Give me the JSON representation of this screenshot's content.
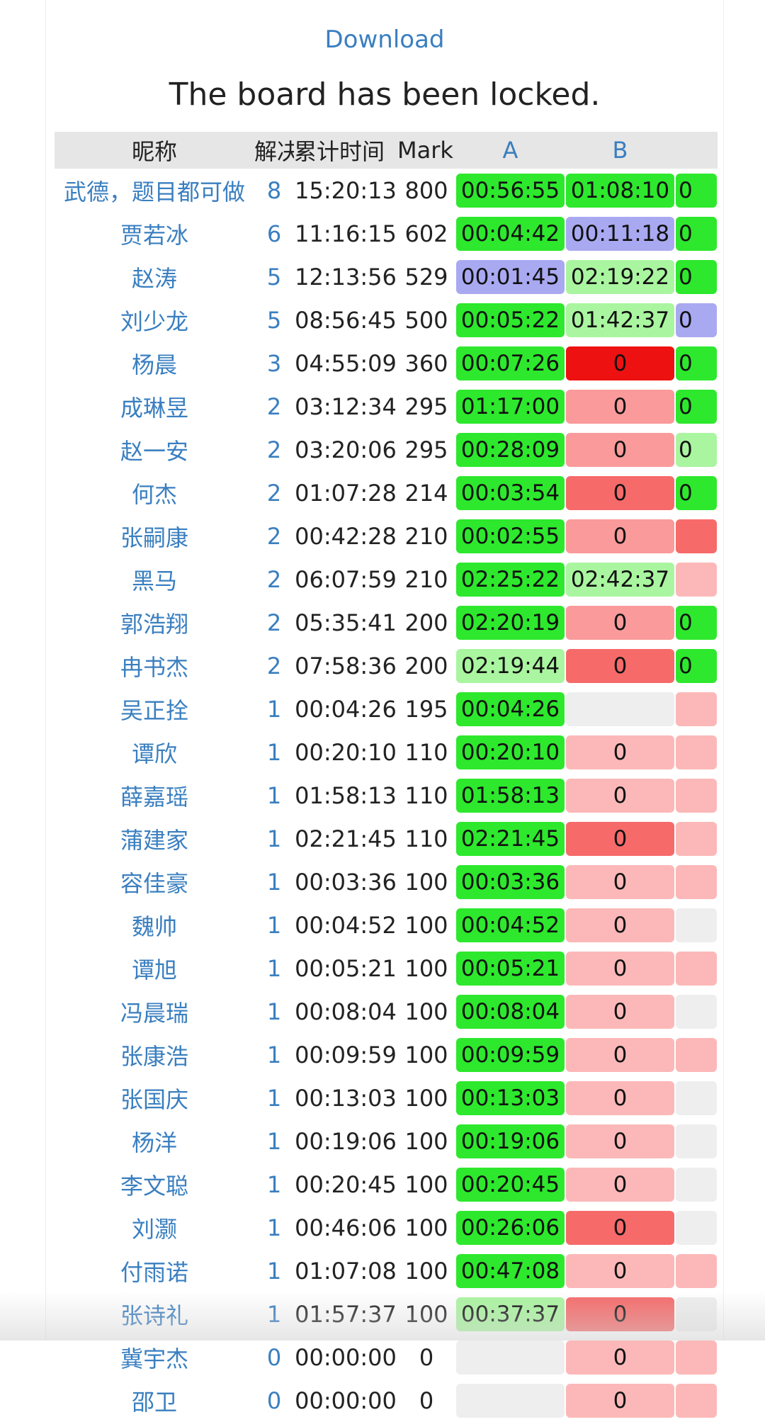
{
  "header": {
    "download_label": "Download",
    "lock_message": "The board has been locked."
  },
  "table": {
    "columns": [
      "昵称",
      "解决",
      "累计时间",
      "Mark",
      "A",
      "B",
      ""
    ],
    "rows": [
      {
        "name": "武德，题目都可做",
        "solved": "8",
        "time": "15:20:13",
        "mark": "800",
        "cells": [
          {
            "v": "00:56:55",
            "s": "ac"
          },
          {
            "v": "01:08:10",
            "s": "ac"
          },
          {
            "v": "0",
            "s": "ac"
          }
        ]
      },
      {
        "name": "贾若冰",
        "solved": "6",
        "time": "11:16:15",
        "mark": "602",
        "cells": [
          {
            "v": "00:04:42",
            "s": "ac"
          },
          {
            "v": "00:11:18",
            "s": "fb"
          },
          {
            "v": "0",
            "s": "ac"
          }
        ]
      },
      {
        "name": "赵涛",
        "solved": "5",
        "time": "12:13:56",
        "mark": "529",
        "cells": [
          {
            "v": "00:01:45",
            "s": "fb"
          },
          {
            "v": "02:19:22",
            "s": "acl"
          },
          {
            "v": "0",
            "s": "ac"
          }
        ]
      },
      {
        "name": "刘少龙",
        "solved": "5",
        "time": "08:56:45",
        "mark": "500",
        "cells": [
          {
            "v": "00:05:22",
            "s": "ac"
          },
          {
            "v": "01:42:37",
            "s": "acl"
          },
          {
            "v": "0",
            "s": "fb"
          }
        ]
      },
      {
        "name": "杨晨",
        "solved": "3",
        "time": "04:55:09",
        "mark": "360",
        "cells": [
          {
            "v": "00:07:26",
            "s": "ac"
          },
          {
            "v": "0",
            "s": "wa3"
          },
          {
            "v": "0",
            "s": "ac"
          }
        ]
      },
      {
        "name": "成琳昱",
        "solved": "2",
        "time": "03:12:34",
        "mark": "295",
        "cells": [
          {
            "v": "01:17:00",
            "s": "ac"
          },
          {
            "v": "0",
            "s": "wa1"
          },
          {
            "v": "0",
            "s": "ac"
          }
        ]
      },
      {
        "name": "赵一安",
        "solved": "2",
        "time": "03:20:06",
        "mark": "295",
        "cells": [
          {
            "v": "00:28:09",
            "s": "ac"
          },
          {
            "v": "0",
            "s": "wa1"
          },
          {
            "v": "0",
            "s": "acl"
          }
        ]
      },
      {
        "name": "何杰",
        "solved": "2",
        "time": "01:07:28",
        "mark": "214",
        "cells": [
          {
            "v": "00:03:54",
            "s": "ac"
          },
          {
            "v": "0",
            "s": "wa2"
          },
          {
            "v": "0",
            "s": "ac"
          }
        ]
      },
      {
        "name": "张嗣康",
        "solved": "2",
        "time": "00:42:28",
        "mark": "210",
        "cells": [
          {
            "v": "00:02:55",
            "s": "ac"
          },
          {
            "v": "0",
            "s": "wa1"
          },
          {
            "v": "",
            "s": "wa2"
          }
        ]
      },
      {
        "name": "黑马",
        "solved": "2",
        "time": "06:07:59",
        "mark": "210",
        "cells": [
          {
            "v": "02:25:22",
            "s": "ac"
          },
          {
            "v": "02:42:37",
            "s": "acl"
          },
          {
            "v": "",
            "s": "wa0"
          }
        ]
      },
      {
        "name": "郭浩翔",
        "solved": "2",
        "time": "05:35:41",
        "mark": "200",
        "cells": [
          {
            "v": "02:20:19",
            "s": "ac"
          },
          {
            "v": "0",
            "s": "wa1"
          },
          {
            "v": "0",
            "s": "ac"
          }
        ]
      },
      {
        "name": "冉书杰",
        "solved": "2",
        "time": "07:58:36",
        "mark": "200",
        "cells": [
          {
            "v": "02:19:44",
            "s": "acl"
          },
          {
            "v": "0",
            "s": "wa2"
          },
          {
            "v": "0",
            "s": "ac"
          }
        ]
      },
      {
        "name": "吴正拴",
        "solved": "1",
        "time": "00:04:26",
        "mark": "195",
        "cells": [
          {
            "v": "00:04:26",
            "s": "ac"
          },
          {
            "v": "",
            "s": "none"
          },
          {
            "v": "",
            "s": "wa0"
          }
        ]
      },
      {
        "name": "谭欣",
        "solved": "1",
        "time": "00:20:10",
        "mark": "110",
        "cells": [
          {
            "v": "00:20:10",
            "s": "ac"
          },
          {
            "v": "0",
            "s": "wa0"
          },
          {
            "v": "",
            "s": "wa0"
          }
        ]
      },
      {
        "name": "薛嘉瑶",
        "solved": "1",
        "time": "01:58:13",
        "mark": "110",
        "cells": [
          {
            "v": "01:58:13",
            "s": "ac"
          },
          {
            "v": "0",
            "s": "wa0"
          },
          {
            "v": "",
            "s": "wa0"
          }
        ]
      },
      {
        "name": "蒲建家",
        "solved": "1",
        "time": "02:21:45",
        "mark": "110",
        "cells": [
          {
            "v": "02:21:45",
            "s": "ac"
          },
          {
            "v": "0",
            "s": "wa2"
          },
          {
            "v": "",
            "s": "wa0"
          }
        ]
      },
      {
        "name": "容佳豪",
        "solved": "1",
        "time": "00:03:36",
        "mark": "100",
        "cells": [
          {
            "v": "00:03:36",
            "s": "ac"
          },
          {
            "v": "0",
            "s": "wa0"
          },
          {
            "v": "",
            "s": "wa0"
          }
        ]
      },
      {
        "name": "魏帅",
        "solved": "1",
        "time": "00:04:52",
        "mark": "100",
        "cells": [
          {
            "v": "00:04:52",
            "s": "ac"
          },
          {
            "v": "0",
            "s": "wa0"
          },
          {
            "v": "",
            "s": "none"
          }
        ]
      },
      {
        "name": "谭旭",
        "solved": "1",
        "time": "00:05:21",
        "mark": "100",
        "cells": [
          {
            "v": "00:05:21",
            "s": "ac"
          },
          {
            "v": "0",
            "s": "wa0"
          },
          {
            "v": "",
            "s": "wa0"
          }
        ]
      },
      {
        "name": "冯晨瑞",
        "solved": "1",
        "time": "00:08:04",
        "mark": "100",
        "cells": [
          {
            "v": "00:08:04",
            "s": "ac"
          },
          {
            "v": "0",
            "s": "wa0"
          },
          {
            "v": "",
            "s": "none"
          }
        ]
      },
      {
        "name": "张康浩",
        "solved": "1",
        "time": "00:09:59",
        "mark": "100",
        "cells": [
          {
            "v": "00:09:59",
            "s": "ac"
          },
          {
            "v": "0",
            "s": "wa0"
          },
          {
            "v": "",
            "s": "wa0"
          }
        ]
      },
      {
        "name": "张国庆",
        "solved": "1",
        "time": "00:13:03",
        "mark": "100",
        "cells": [
          {
            "v": "00:13:03",
            "s": "ac"
          },
          {
            "v": "0",
            "s": "wa0"
          },
          {
            "v": "",
            "s": "none"
          }
        ]
      },
      {
        "name": "杨洋",
        "solved": "1",
        "time": "00:19:06",
        "mark": "100",
        "cells": [
          {
            "v": "00:19:06",
            "s": "ac"
          },
          {
            "v": "0",
            "s": "wa0"
          },
          {
            "v": "",
            "s": "none"
          }
        ]
      },
      {
        "name": "李文聪",
        "solved": "1",
        "time": "00:20:45",
        "mark": "100",
        "cells": [
          {
            "v": "00:20:45",
            "s": "ac"
          },
          {
            "v": "0",
            "s": "wa0"
          },
          {
            "v": "",
            "s": "none"
          }
        ]
      },
      {
        "name": "刘灏",
        "solved": "1",
        "time": "00:46:06",
        "mark": "100",
        "cells": [
          {
            "v": "00:26:06",
            "s": "ac"
          },
          {
            "v": "0",
            "s": "wa2"
          },
          {
            "v": "",
            "s": "none"
          }
        ]
      },
      {
        "name": "付雨诺",
        "solved": "1",
        "time": "01:07:08",
        "mark": "100",
        "cells": [
          {
            "v": "00:47:08",
            "s": "ac"
          },
          {
            "v": "0",
            "s": "wa0"
          },
          {
            "v": "",
            "s": "wa0"
          }
        ]
      },
      {
        "name": "张诗礼",
        "solved": "1",
        "time": "01:57:37",
        "mark": "100",
        "cells": [
          {
            "v": "00:37:37",
            "s": "acl"
          },
          {
            "v": "0",
            "s": "wa2"
          },
          {
            "v": "",
            "s": "none"
          }
        ]
      },
      {
        "name": "冀宇杰",
        "solved": "0",
        "time": "00:00:00",
        "mark": "0",
        "cells": [
          {
            "v": "",
            "s": "none"
          },
          {
            "v": "0",
            "s": "wa0"
          },
          {
            "v": "",
            "s": "wa0"
          }
        ]
      },
      {
        "name": "邵卫",
        "solved": "0",
        "time": "00:00:00",
        "mark": "0",
        "cells": [
          {
            "v": "",
            "s": "none"
          },
          {
            "v": "0",
            "s": "wa0"
          },
          {
            "v": "",
            "s": "wa0"
          }
        ]
      }
    ]
  },
  "colors": {
    "ac": "#2de82d",
    "acl": "#aaf5a0",
    "fb": "#a9a9f2",
    "wa0": "#fcb8b8",
    "wa1": "#fa9a9a",
    "wa2": "#f66a6a",
    "wa3": "#ee1111",
    "none": "#eeeeee"
  }
}
